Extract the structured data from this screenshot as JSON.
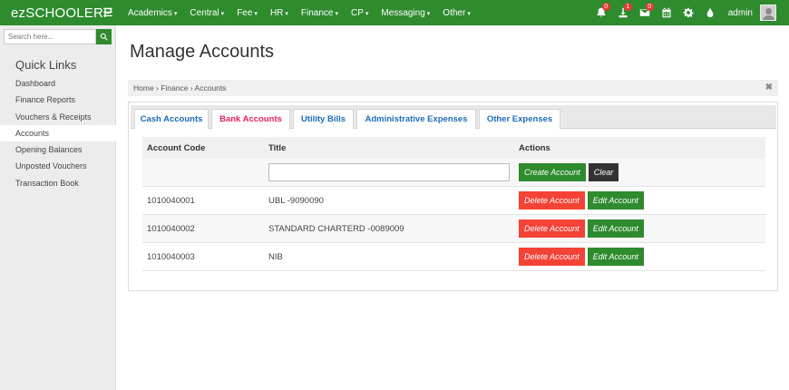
{
  "topbar": {
    "brand": "ezSCHOOLERP",
    "menu_icon": "hamburger-icon",
    "nav": [
      "Academics",
      "Central",
      "Fee",
      "HR",
      "Finance",
      "CP",
      "Messaging",
      "Other"
    ],
    "notifications_badge": "0",
    "download_badge": "1",
    "messages_badge": "0",
    "user": "admin",
    "colors": {
      "bar": "#2e8b2e",
      "badge": "#e53935"
    }
  },
  "sidebar": {
    "search_placeholder": "Search here...",
    "quick_links_title": "Quick Links",
    "items": [
      {
        "label": "Dashboard"
      },
      {
        "label": "Finance Reports"
      },
      {
        "label": "Vouchers & Receipts"
      },
      {
        "label": "Accounts"
      },
      {
        "label": "Opening Balances"
      },
      {
        "label": "Unposted Vouchers"
      },
      {
        "label": "Transaction Book"
      }
    ]
  },
  "main": {
    "title": "Manage Accounts",
    "breadcrumb": "Home › Finance › Accounts",
    "close_symbol": "✖",
    "tabs": [
      {
        "label": "Cash Accounts"
      },
      {
        "label": "Bank Accounts"
      },
      {
        "label": "Utility Bills"
      },
      {
        "label": "Administrative Expenses"
      },
      {
        "label": "Other Expenses"
      }
    ],
    "active_tab": "Bank Accounts",
    "table": {
      "headers": {
        "code": "Account Code",
        "title": "Title",
        "actions": "Actions"
      },
      "new_row": {
        "title_value": "",
        "create_label": "Create Account",
        "clear_label": "Clear"
      },
      "rows": [
        {
          "code": "1010040001",
          "title": "UBL -9090090",
          "delete": "Delete Account",
          "edit": "Edit Account"
        },
        {
          "code": "1010040002",
          "title": "STANDARD CHARTERD -0089009",
          "delete": "Delete Account",
          "edit": "Edit Account"
        },
        {
          "code": "1010040003",
          "title": "NIB",
          "delete": "Delete Account",
          "edit": "Edit Account"
        }
      ]
    }
  }
}
